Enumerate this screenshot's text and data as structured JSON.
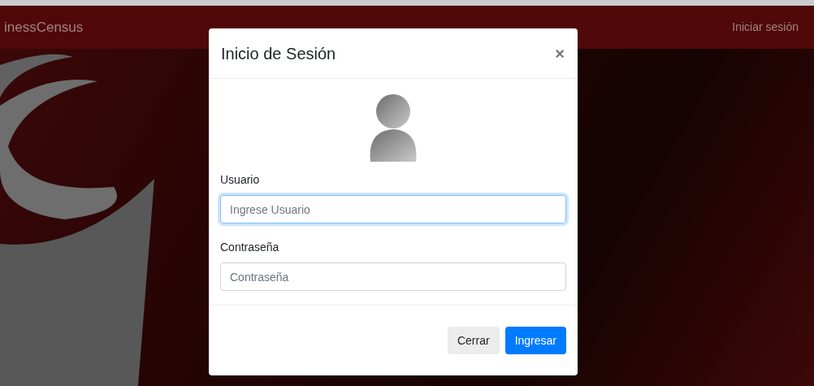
{
  "navbar": {
    "brand": "inessCensus",
    "login_link": "Iniciar sesión"
  },
  "modal": {
    "title": "Inicio de Sesión",
    "close": "×",
    "fields": [
      {
        "label": "Usuario",
        "placeholder": "Ingrese Usuario",
        "focused": true
      },
      {
        "label": "Contraseña",
        "placeholder": "Contraseña",
        "focused": false
      }
    ],
    "buttons": [
      {
        "label": "Cerrar",
        "kind": "secondary"
      },
      {
        "label": "Ingresar",
        "kind": "primary"
      }
    ]
  }
}
